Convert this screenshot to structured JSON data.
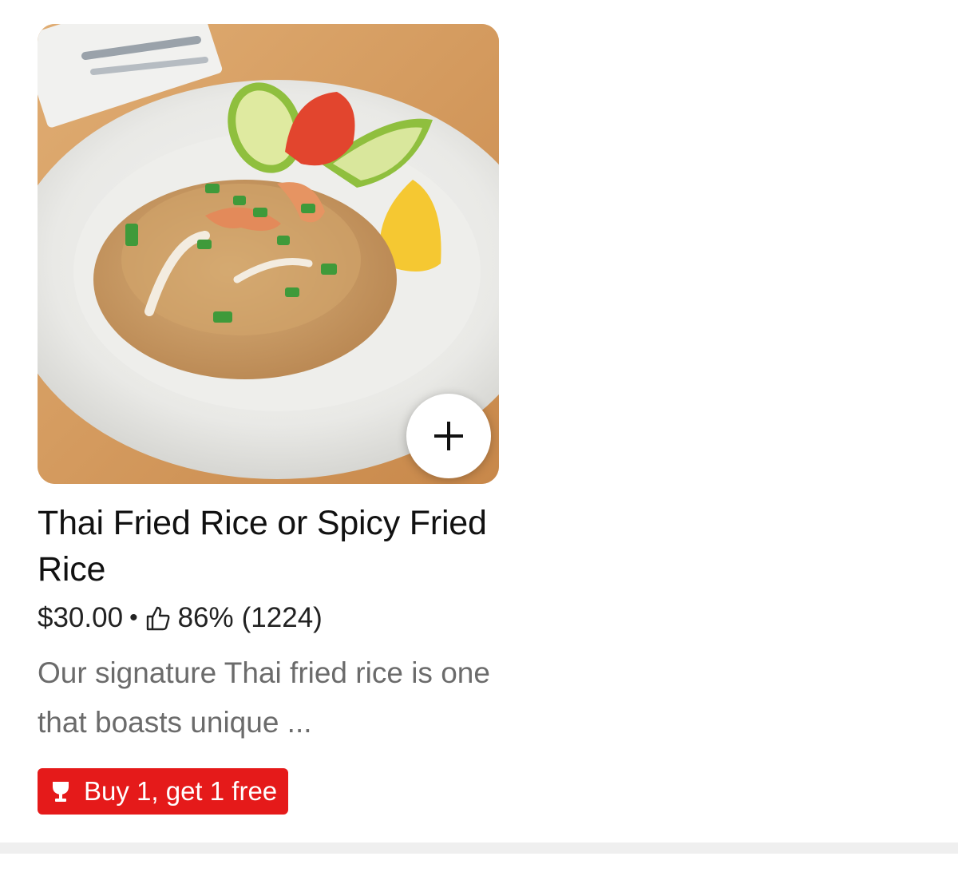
{
  "item": {
    "title": "Thai Fried Rice or Spicy Fried Rice",
    "price": "$30.00",
    "separator": "•",
    "rating_percent": "86%",
    "rating_count": "(1224)",
    "description": "Our signature Thai fried rice is one that boasts unique ...",
    "promo_label": "Buy 1, get 1 free",
    "image_alt": "Thai fried rice with shrimp, cucumber, tomato and lemon on a white plate",
    "icons": {
      "add": "plus-icon",
      "rating": "thumbs-up-icon",
      "promo": "trophy-icon"
    }
  },
  "colors": {
    "promo_bg": "#e51a1a",
    "title": "#111111",
    "description": "#6b6b6b",
    "divider": "#efefef"
  }
}
